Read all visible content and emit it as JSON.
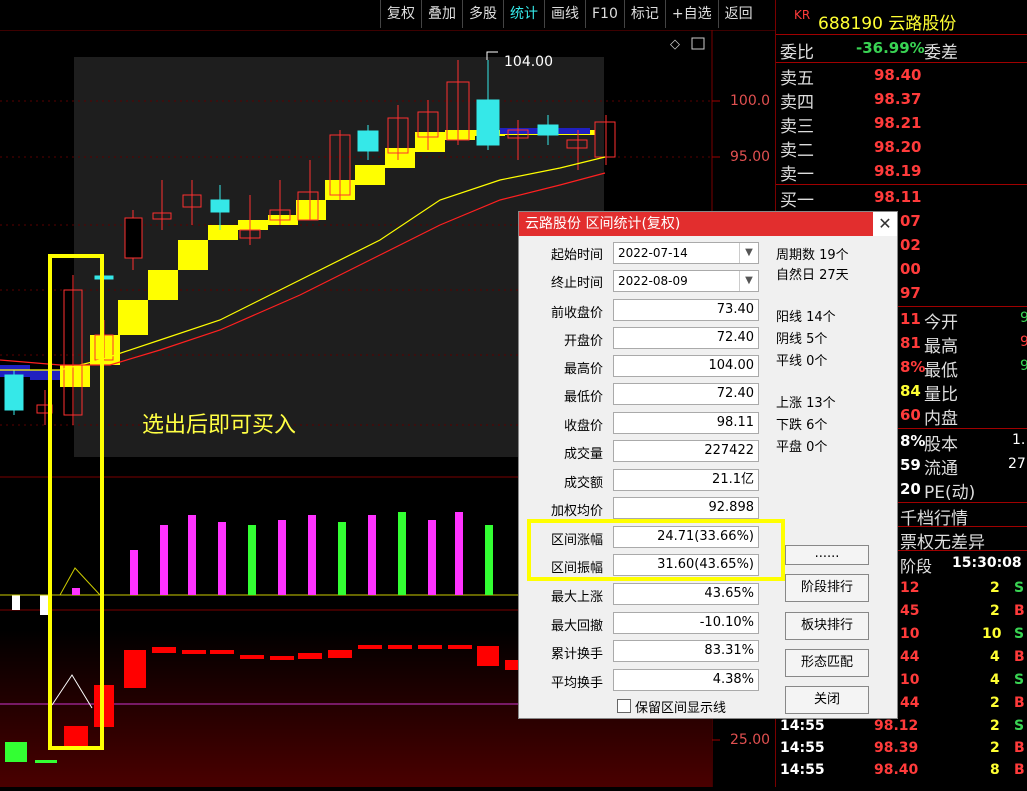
{
  "toolbar": {
    "buttons": [
      "复权",
      "叠加",
      "多股",
      "统计",
      "画线",
      "F10",
      "标记",
      "+自选",
      "返回"
    ]
  },
  "chart": {
    "price_axis": [
      "100.0",
      "95.00",
      "25.00"
    ],
    "high_marker": "104.00",
    "annotation": "选出后即可买入",
    "colors": {
      "up": "#ff3030",
      "down": "#35e8e8",
      "ma_fast": "#ffff00",
      "ma_slow": "#ff2020",
      "block": "#ffff00",
      "volume_up": "#ff33ff",
      "volume_down": "#33ff33"
    }
  },
  "right_panel": {
    "stock_code_prefix": "KR",
    "stock_code": "688190",
    "stock_name": "云路股份",
    "wei_bi_label": "委比",
    "wei_bi_value": "-36.99%",
    "wei_cha_label": "委差",
    "asks": [
      {
        "label": "卖五",
        "price": "98.40"
      },
      {
        "label": "卖四",
        "price": "98.37"
      },
      {
        "label": "卖三",
        "price": "98.21"
      },
      {
        "label": "卖二",
        "price": "98.20"
      },
      {
        "label": "卖一",
        "price": "98.19"
      }
    ],
    "bid1": {
      "label": "买一",
      "price": "98.11"
    },
    "partial_vals": [
      "07",
      "02",
      "00",
      "97",
      "11",
      "81",
      "8%",
      "84",
      "60",
      "8%",
      "59",
      "20"
    ],
    "stats": [
      {
        "label": "今开",
        "val": "9"
      },
      {
        "label": "最高",
        "val": "9"
      },
      {
        "label": "最低",
        "val": "9"
      },
      {
        "label": "量比",
        "val": ""
      },
      {
        "label": "内盘",
        "val": ""
      },
      {
        "label": "股本",
        "val": "1."
      },
      {
        "label": "流通",
        "val": "27"
      },
      {
        "label": "PE(动)",
        "val": ""
      }
    ],
    "qian_dang": "千档行情",
    "option_text": "票权无差异",
    "period_label": "阶段",
    "period_time": "15:30:08",
    "ticks": [
      {
        "time": "",
        "price": "12",
        "vol": "2",
        "side": "S"
      },
      {
        "time": "",
        "price": "45",
        "vol": "2",
        "side": "B"
      },
      {
        "time": "",
        "price": "10",
        "vol": "10",
        "side": "S"
      },
      {
        "time": "",
        "price": "44",
        "vol": "4",
        "side": "B"
      },
      {
        "time": "",
        "price": "10",
        "vol": "4",
        "side": "S"
      },
      {
        "time": "",
        "price": "44",
        "vol": "2",
        "side": "B"
      },
      {
        "time": "14:55",
        "price": "98.12",
        "vol": "2",
        "side": "S"
      },
      {
        "time": "14:55",
        "price": "98.39",
        "vol": "2",
        "side": "B"
      },
      {
        "time": "14:55",
        "price": "98.40",
        "vol": "8",
        "side": "B"
      }
    ]
  },
  "dialog": {
    "title": "云路股份 区间统计(复权)",
    "start_label": "起始时间",
    "start_date": "2022-07-14",
    "end_label": "终止时间",
    "end_date": "2022-08-09",
    "rows": [
      {
        "label": "前收盘价",
        "value": "73.40"
      },
      {
        "label": "开盘价",
        "value": "72.40"
      },
      {
        "label": "最高价",
        "value": "104.00"
      },
      {
        "label": "最低价",
        "value": "72.40"
      },
      {
        "label": "收盘价",
        "value": "98.11"
      },
      {
        "label": "成交量",
        "value": "227422"
      },
      {
        "label": "成交额",
        "value": "21.1亿"
      },
      {
        "label": "加权均价",
        "value": "92.898"
      },
      {
        "label": "区间涨幅",
        "value": "24.71(33.66%)"
      },
      {
        "label": "区间振幅",
        "value": "31.60(43.65%)"
      },
      {
        "label": "最大上涨",
        "value": "43.65%"
      },
      {
        "label": "最大回撤",
        "value": "-10.10%"
      },
      {
        "label": "累计换手",
        "value": "83.31%"
      },
      {
        "label": "平均换手",
        "value": "4.38%"
      }
    ],
    "info": {
      "period_count": "周期数 19个",
      "natural_days": "自然日 27天",
      "yang": "阳线 14个",
      "yin": "阴线 5个",
      "ping": "平线 0个",
      "up": "上涨 13个",
      "down": "下跌 6个",
      "flat": "平盘 0个"
    },
    "buttons": {
      "dots": "......",
      "rank": "阶段排行",
      "sector_rank": "板块排行",
      "pattern": "形态匹配",
      "close": "关闭"
    },
    "keep_checkbox": "保留区间显示线"
  }
}
